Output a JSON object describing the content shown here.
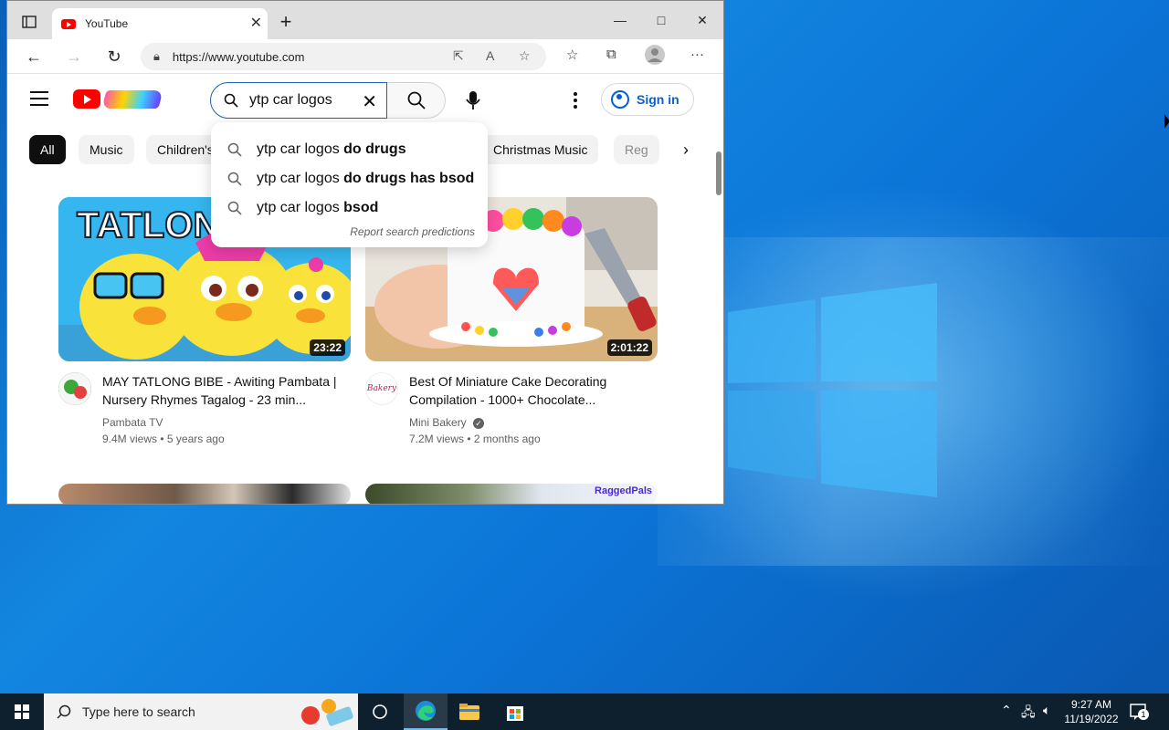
{
  "browser": {
    "tab_title": "YouTube",
    "url": "https://www.youtube.com",
    "window_controls": {
      "minimize": "—",
      "maximize": "□",
      "close": "✕"
    }
  },
  "youtube": {
    "search_query": "ytp car logos",
    "signin_label": "Sign in",
    "chips": [
      "All",
      "Music",
      "Children's",
      "Christmas Music",
      "Reg"
    ],
    "suggestions": [
      {
        "prefix": "ytp car logos ",
        "bold": "do drugs"
      },
      {
        "prefix": "ytp car logos ",
        "bold": "do drugs has bsod"
      },
      {
        "prefix": "ytp car logos ",
        "bold": "bsod"
      }
    ],
    "report_label": "Report search predictions",
    "videos": [
      {
        "title": "MAY TATLONG BIBE - Awiting Pambata | Nursery Rhymes Tagalog - 23 min...",
        "thumb_text": "TATLON",
        "duration": "23:22",
        "channel": "Pambata TV",
        "views": "9.4M views",
        "age": "5 years ago"
      },
      {
        "title": "Best Of Miniature Cake Decorating Compilation - 1000+ Chocolate...",
        "duration": "2:01:22",
        "channel": "Mini Bakery",
        "avatar_text": "Bakery",
        "views": "7.2M views",
        "age": "2 months ago"
      }
    ],
    "lower_thumb_text": "RaggedPals"
  },
  "taskbar": {
    "search_placeholder": "Type here to search",
    "time": "9:27 AM",
    "date": "11/19/2022",
    "notification_count": "1"
  },
  "colors": {
    "accent_blue": "#065fd4",
    "youtube_red": "#ff0000",
    "taskbar": "#0e1f2e"
  }
}
